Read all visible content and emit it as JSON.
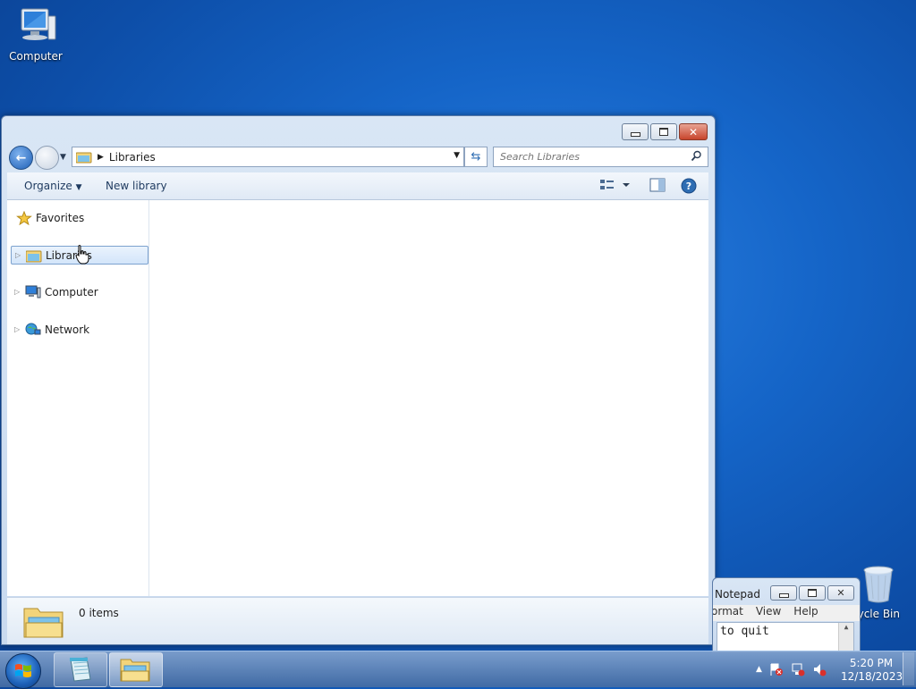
{
  "desktop": {
    "icons": [
      {
        "label": "Computer",
        "icon": "computer-icon"
      },
      {
        "label": "cycle Bin",
        "icon": "recycle-bin-icon"
      }
    ]
  },
  "explorer": {
    "address": {
      "breadcrumb": "Libraries"
    },
    "search": {
      "placeholder": "Search Libraries"
    },
    "toolbar": {
      "organize": "Organize",
      "new_library": "New library"
    },
    "navpane": [
      {
        "label": "Favorites",
        "icon": "star-icon"
      },
      {
        "label": "Libraries",
        "icon": "libraries-icon",
        "selected": true
      },
      {
        "label": "Computer",
        "icon": "computer-icon"
      },
      {
        "label": "Network",
        "icon": "network-icon"
      }
    ],
    "details": {
      "count": "0 items"
    }
  },
  "notepad": {
    "title": "Notepad",
    "menu": [
      "ormat",
      "View",
      "Help"
    ],
    "text": "to quit"
  },
  "taskbar": {
    "clock": {
      "time": "5:20 PM",
      "date": "12/18/2023"
    }
  }
}
